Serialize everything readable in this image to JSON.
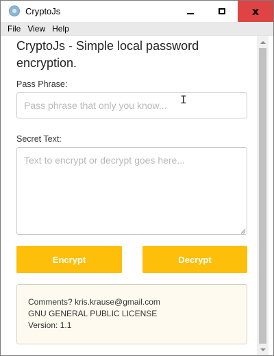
{
  "window": {
    "title": "CryptoJs",
    "minimize_icon": "minimize-icon",
    "maximize_icon": "maximize-icon",
    "close_icon": "close-icon",
    "close_label": "x"
  },
  "menu": {
    "items": [
      "File",
      "View",
      "Help"
    ]
  },
  "main": {
    "heading": "CryptoJs - Simple local password encryption.",
    "pass_label": "Pass Phrase:",
    "pass_placeholder": "Pass phrase that only you know...",
    "pass_value": "",
    "secret_label": "Secret Text:",
    "secret_placeholder": "Text to encrypt or decrypt goes here...",
    "secret_value": "",
    "encrypt_label": "Encrypt",
    "decrypt_label": "Decrypt",
    "button_color": "#fdbf0a"
  },
  "info": {
    "comments": "Comments? kris.krause@gmail.com",
    "license": "GNU GENERAL PUBLIC LICENSE",
    "version": "Version: 1.1"
  }
}
